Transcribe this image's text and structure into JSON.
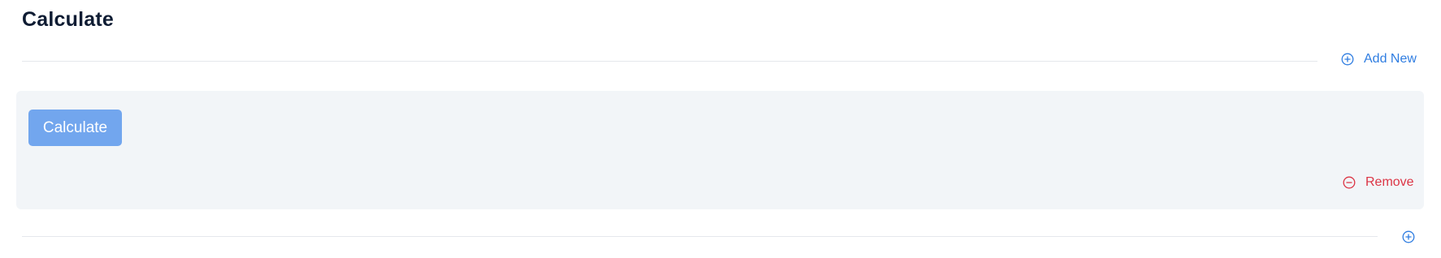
{
  "section": {
    "title": "Calculate",
    "add_new_label": "Add New"
  },
  "block": {
    "button_label": "Calculate",
    "remove_label": "Remove"
  },
  "icons": {
    "add": "plus-circle-icon",
    "remove": "minus-circle-icon"
  },
  "colors": {
    "title": "#0f1c33",
    "link": "#2f7de1",
    "danger": "#dc3545",
    "button_bg": "#72a6ee",
    "panel_bg": "#f2f5f8",
    "divider": "#e5e8ec"
  }
}
